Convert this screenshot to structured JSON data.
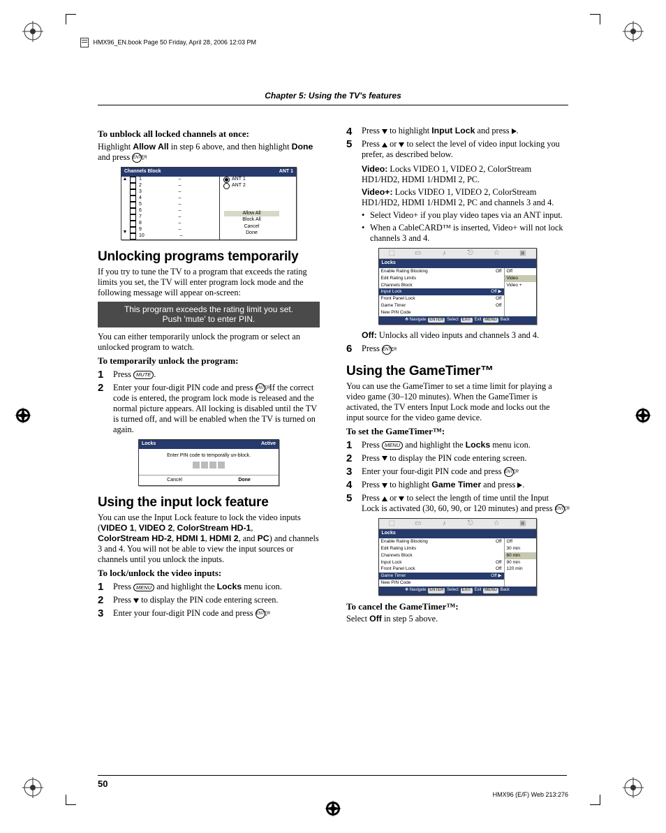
{
  "fm_line": "HMX96_EN.book  Page 50  Friday, April 28, 2006  12:03 PM",
  "chapter_title": "Chapter 5: Using the TV's features",
  "page_number": "50",
  "footer_code": "HMX96 (E/F) Web 213:276",
  "col1": {
    "unblock_h": "To unblock all locked channels at once:",
    "unblock_p1a": "Highlight ",
    "unblock_p1b": "Allow All",
    "unblock_p1c": " in step 6 above, and then highlight ",
    "unblock_p1d": "Done",
    "unblock_p1e": " and press ",
    "key_enter": "ENTER",
    "chblock": {
      "title": "Channels Block",
      "ant": "ANT 1",
      "rows": [
        "1",
        "2",
        "3",
        "4",
        "5",
        "6",
        "7",
        "8",
        "9",
        "10"
      ],
      "ant1": "ANT 1",
      "ant2": "ANT 2",
      "allow": "Allow All",
      "block": "Block All",
      "cancel": "Cancel",
      "done": "Done"
    },
    "unlock_h2": "Unlocking programs temporarily",
    "unlock_p1": "If you try to tune the TV to a program that exceeds the rating limits you set, the TV will enter program lock mode and the following message will appear on-screen:",
    "msg1": "This program exceeds the rating limit you set.",
    "msg2": "Push 'mute' to enter PIN.",
    "unlock_p2": "You can either temporarily unlock the program or select an unlocked program to watch.",
    "temp_h": "To temporarily unlock the program:",
    "step1a": "Press ",
    "key_mute": "MUTE",
    "step2a": "Enter your four-digit PIN code and press ",
    "step2b": ". If the correct code is entered, the program lock mode is released and the normal picture appears. All locking is disabled until the TV is turned off, and will be enabled when the TV is turned on again.",
    "pinpanel": {
      "title": "Locks",
      "status": "Active",
      "msg": "Enter PIN code to temporally un-block.",
      "cancel": "Cancel",
      "done": "Done"
    },
    "inputlock_h2": "Using the input lock feature",
    "inputlock_p1a": "You can use the Input Lock feature to lock the video inputs (",
    "inputlock_p1_v1": "VIDEO 1",
    "inputlock_p1_v2": "VIDEO 2",
    "inputlock_p1_v3": "ColorStream HD-1",
    "inputlock_p1_v4": "ColorStream HD-2",
    "inputlock_p1_v5": "HDMI 1",
    "inputlock_p1_v6": "HDMI 2",
    "inputlock_p1_v7": "PC",
    "inputlock_p1b": ") and channels 3 and 4. You will not be able to view the input sources or channels until you unlock the inputs.",
    "lockvid_h": "To lock/unlock the video inputs:",
    "lv1a": "Press ",
    "key_menu": "MENU",
    "lv1b": " and highlight the ",
    "lv1c": "Locks",
    "lv1d": " menu icon.",
    "lv2a": "Press ",
    "lv2b": " to display the PIN code entering screen.",
    "lv3a": "Enter your four-digit PIN code and press ",
    "lv4a": "Press ",
    "lv4b": " to highlight ",
    "lv4c": "Input Lock",
    "lv4d": " and press ",
    "lv5a": "Press ",
    "lv5b": " or ",
    "lv5c": " to select the level of video input locking you prefer, as described below."
  },
  "col2": {
    "video_l": "Video:",
    "video_t": " Locks VIDEO 1, VIDEO 2, ColorStream HD1/HD2, HDMI 1/HDMI 2, PC.",
    "videop_l": "Video+:",
    "videop_t": " Locks VIDEO 1, VIDEO 2, ColorStream HD1/HD2, HDMI 1/HDMI 2, PC and channels 3 and 4.",
    "b1": "Select Video+ if you play video tapes via an ANT input.",
    "b2": "When a CableCARD™ is inserted, Video+ will not lock channels 3 and 4.",
    "lockspanel1": {
      "title": "Locks",
      "rows": [
        {
          "l": "Enable Rating Blocking",
          "r": "Off"
        },
        {
          "l": "Edit Rating Limits",
          "r": ""
        },
        {
          "l": "Channels Block",
          "r": ""
        },
        {
          "l": "Input Lock",
          "r": "Off  ▶",
          "sel": true
        },
        {
          "l": "Front Panel Lock",
          "r": "Off"
        },
        {
          "l": "Game Timer",
          "r": "Off"
        },
        {
          "l": "New PIN Code",
          "r": ""
        }
      ],
      "opts": [
        "Off",
        "Video",
        "Video +"
      ],
      "opt_sel": 1,
      "foot_nav": "Navigate",
      "foot_sel": "Select",
      "foot_exit": "Exit",
      "foot_back": "Back"
    },
    "off_l": "Off:",
    "off_t": " Unlocks all video inputs and channels 3 and 4.",
    "step6": "Press ",
    "gt_h2": "Using the GameTimer™",
    "gt_p1": "You can use the GameTimer to set a time limit for playing a video game (30–120 minutes). When the GameTimer is activated, the TV enters Input Lock mode and locks out the input source for the video game device.",
    "gt_set_h": "To set the GameTimer™:",
    "gt1a": "Press ",
    "gt1b": " and highlight the ",
    "gt1c": "Locks",
    "gt1d": " menu icon.",
    "gt2a": "Press ",
    "gt2b": " to display the PIN code entering screen.",
    "gt3a": "Enter your four-digit PIN code and press ",
    "gt4a": "Press ",
    "gt4b": " to highlight ",
    "gt4c": "Game Timer",
    "gt4d": " and press ",
    "gt5a": "Press ",
    "gt5b": " or ",
    "gt5c": " to select the length of time until the Input Lock is activated (30, 60, 90, or 120 minutes) and press ",
    "lockspanel2": {
      "title": "Locks",
      "rows": [
        {
          "l": "Enable Rating Blocking",
          "r": "Off"
        },
        {
          "l": "Edit Rating Limits",
          "r": ""
        },
        {
          "l": "Channels Block",
          "r": ""
        },
        {
          "l": "Input Lock",
          "r": "Off"
        },
        {
          "l": "Front Panel Lock",
          "r": "Off"
        },
        {
          "l": "Game Timer",
          "r": "Off  ▶",
          "sel": true
        },
        {
          "l": "New PIN Code",
          "r": ""
        }
      ],
      "opts": [
        "Off",
        "30 min",
        "60 min",
        "90 min",
        "120 min"
      ],
      "opt_sel": 2,
      "foot_nav": "Navigate",
      "foot_sel": "Select",
      "foot_exit": "Exit",
      "foot_back": "Back"
    },
    "gt_cancel_h": "To cancel the GameTimer™:",
    "gt_cancel_p1a": "Select ",
    "gt_cancel_p1b": "Off",
    "gt_cancel_p1c": " in step 5 above."
  }
}
